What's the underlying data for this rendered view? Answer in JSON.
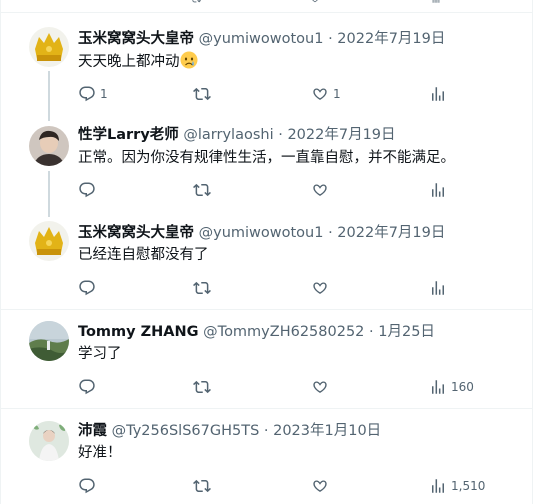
{
  "tweets": [
    {
      "name": "玉米窝窝头大皇帝",
      "handle": "@yumiwowotou1",
      "sep": "·",
      "date": "2022年7月19日",
      "text": "天天晚上都冲动",
      "emoji": "worried-face-icon",
      "replies": "1",
      "retweets": "",
      "likes": "1",
      "views": ""
    },
    {
      "name": "性学Larry老师",
      "handle": "@larrylaoshi",
      "sep": "·",
      "date": "2022年7月19日",
      "text": "正常。因为你没有规律性生活，一直靠自慰，并不能满足。",
      "replies": "",
      "retweets": "",
      "likes": "",
      "views": ""
    },
    {
      "name": "玉米窝窝头大皇帝",
      "handle": "@yumiwowotou1",
      "sep": "·",
      "date": "2022年7月19日",
      "text": "已经连自慰都没有了",
      "replies": "",
      "retweets": "",
      "likes": "",
      "views": ""
    },
    {
      "name": "Tommy ZHANG",
      "handle": "@TommyZH62580252",
      "sep": "·",
      "date": "1月25日",
      "text": "学习了",
      "replies": "",
      "retweets": "",
      "likes": "",
      "views": "160"
    },
    {
      "name": "沛霞",
      "handle": "@Ty256SlS67GH5TS",
      "sep": "·",
      "date": "2023年1月10日",
      "text": "好准！",
      "replies": "",
      "retweets": "",
      "likes": "",
      "views": "1,510"
    }
  ],
  "colors": {
    "text": "#0f1419",
    "muted": "#536471",
    "thread_line": "#cfd9de",
    "divider": "#eff3f4"
  }
}
